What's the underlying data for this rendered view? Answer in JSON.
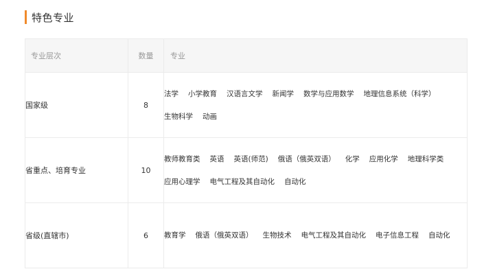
{
  "section": {
    "title": "特色专业"
  },
  "accent_color": "#f08a2b",
  "table": {
    "headers": {
      "level": "专业层次",
      "count": "数量",
      "majors": "专业"
    },
    "rows": [
      {
        "level": "国家级",
        "count": "8",
        "majors": [
          "法学",
          "小学教育",
          "汉语言文学",
          "新闻学",
          "数学与应用数学",
          "地理信息系统（科学）",
          "生物科学",
          "动画"
        ]
      },
      {
        "level": "省重点、培育专业",
        "count": "10",
        "majors": [
          "教师教育类",
          "英语",
          "英语(师范)",
          "俄语（俄英双语）",
          "化学",
          "应用化学",
          "地理科学类",
          "应用心理学",
          "电气工程及其自动化",
          "自动化"
        ]
      },
      {
        "level": "省级(直辖市)",
        "count": "6",
        "majors": [
          "教育学",
          "俄语（俄英双语）",
          "生物技术",
          "电气工程及其自动化",
          "电子信息工程",
          "自动化"
        ]
      }
    ]
  }
}
